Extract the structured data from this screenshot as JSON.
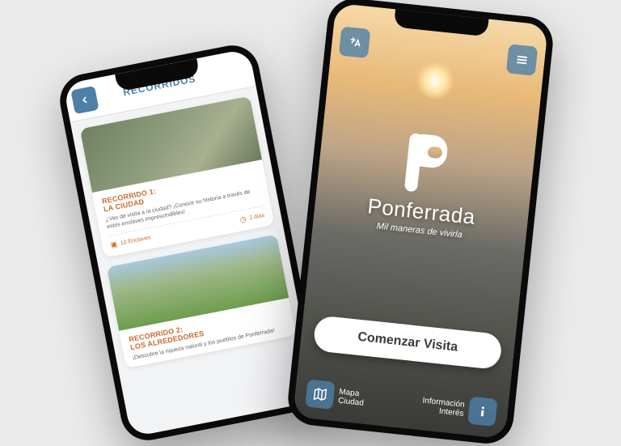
{
  "back": {
    "header_title": "RECORRIDOS",
    "routes": [
      {
        "title_line1": "RECORRIDO 1:",
        "title_line2": "LA CIUDAD",
        "desc": "¿Vas de visita a la ciudad? ¡Conoce su historia a través de estos enclaves imprescindibles!",
        "enclaves": "10 Enclaves",
        "duration": "2 días"
      },
      {
        "title_line1": "RECORRIDO 2:",
        "title_line2": "LOS ALREDEDORES",
        "desc": "¡Descubre la riqueza natural y los pueblos de Ponferrada!",
        "enclaves": "",
        "duration": ""
      }
    ]
  },
  "front": {
    "brand": "Ponferrada",
    "tagline": "Mil maneras de vivirla",
    "cta": "Comenzar Visita",
    "bottom_left_line1": "Mapa",
    "bottom_left_line2": "Ciudad",
    "bottom_right_line1": "Información",
    "bottom_right_line2": "Interés"
  },
  "colors": {
    "primary": "#4d7fa8",
    "accent": "#c86b2e"
  }
}
